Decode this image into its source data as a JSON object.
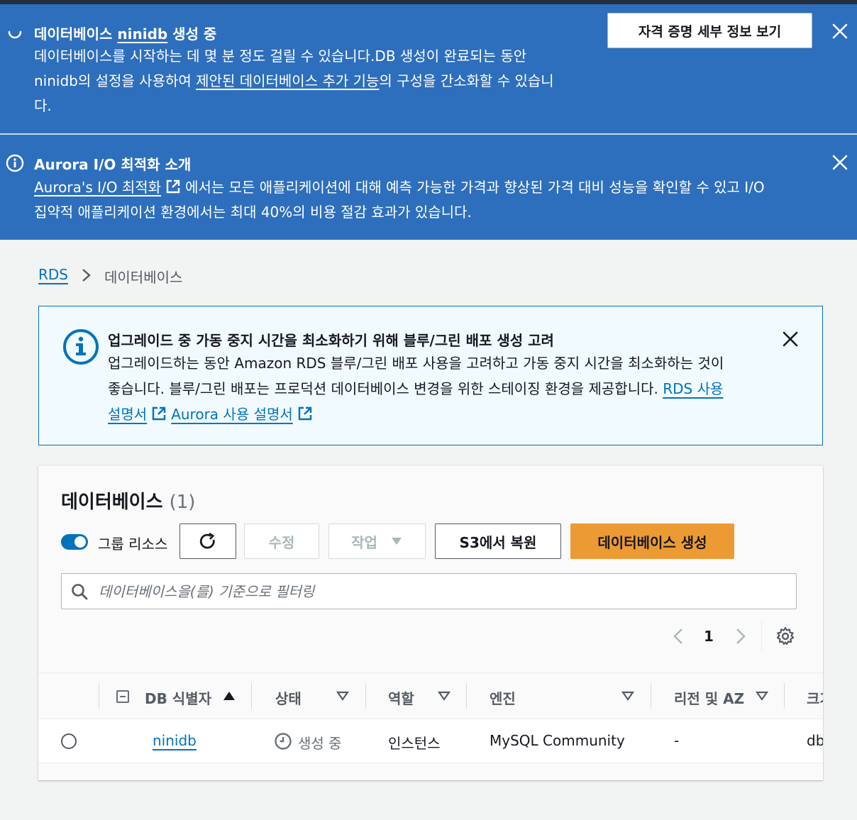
{
  "flash_creating": {
    "title_prefix": "데이터베이스 ",
    "title_db": "ninidb",
    "title_suffix": " 생성 중",
    "body_line1": "데이터베이스를 시작하는 데 몇 분 정도 걸릴 수 있습니다.DB 생성이 완료되는 동안",
    "body_line2_prefix": "ninidb의 설정을 사용하여 ",
    "body_line2_link": "제안된 데이터베이스 추가 기능",
    "body_line2_suffix": "의 구성을 간소화할 수 있습니",
    "body_line3": "다.",
    "button": "자격 증명 세부 정보 보기"
  },
  "flash_aurora": {
    "title": "Aurora I/O 최적화 소개",
    "link": "Aurora's I/O 최적화",
    "body_line1_suffix": "에서는 모든 애플리케이션에 대해 예측 가능한 가격과 향상된 가격 대비 성능을 확인할 수 있고 I/O",
    "body_line2": "집약적 애플리케이션 환경에서는 최대 40%의 비용 절감 효과가 있습니다."
  },
  "breadcrumb": {
    "root": "RDS",
    "current": "데이터베이스"
  },
  "alert": {
    "title": "업그레이드 중 가동 중지 시간을 최소화하기 위해 블루/그린 배포 생성 고려",
    "body_line1": "업그레이드하는 동안 Amazon RDS 블루/그린 배포 사용을 고려하고 가동 중지 시간을 최소화하는 것이",
    "body_line2": "좋습니다. 블루/그린 배포는 프로덕션 데이터베이스 변경을 위한 스테이징 환경을 제공합니다. ",
    "link_rds_a": "RDS 사용",
    "link_rds_b": "설명서",
    "link_aurora": "Aurora 사용 설명서"
  },
  "panel": {
    "title": "데이터베이스",
    "count": "(1)",
    "toggle_label": "그룹 리소스",
    "toggle_on": true,
    "btn_modify": "수정",
    "btn_actions": "작업",
    "btn_restore": "S3에서 복원",
    "btn_create": "데이터베이스 생성",
    "search_placeholder": "데이터베이스을(를) 기준으로 필터링",
    "page": "1"
  },
  "table": {
    "columns": [
      "DB 식별자",
      "상태",
      "역할",
      "엔진",
      "리전 및 AZ",
      "크기"
    ],
    "rows": [
      {
        "id": "ninidb",
        "status": "생성 중",
        "role": "인스턴스",
        "engine": "MySQL Community",
        "region": "-",
        "size": "db"
      }
    ]
  },
  "colors": {
    "flash": "#2e6fbd",
    "link": "#0073bb",
    "primary": "#ec9a33"
  }
}
